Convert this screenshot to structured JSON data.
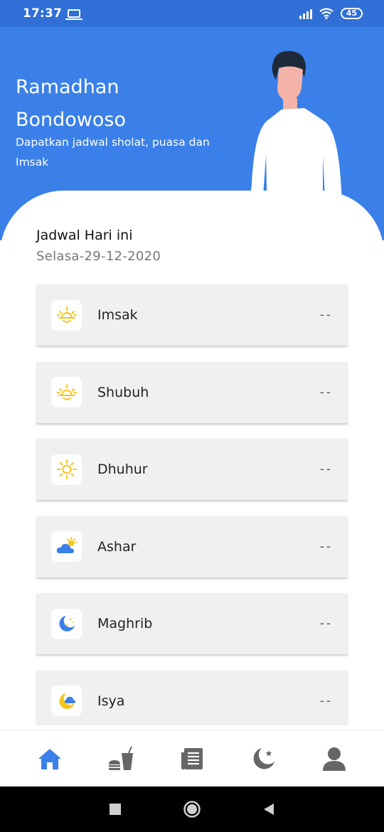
{
  "status_bar": {
    "time": "17:37",
    "battery": "45"
  },
  "header": {
    "title_line1": "Ramadhan",
    "title_line2": "Bondowoso",
    "subtitle": "Dapatkan jadwal sholat, puasa dan Imsak"
  },
  "schedule": {
    "title": "Jadwal Hari ini",
    "date": "Selasa-29-12-2020",
    "items": [
      {
        "name": "Imsak",
        "time": "--",
        "icon": "sunrise-icon"
      },
      {
        "name": "Shubuh",
        "time": "--",
        "icon": "sunrise-icon"
      },
      {
        "name": "Dhuhur",
        "time": "--",
        "icon": "sun-icon"
      },
      {
        "name": "Ashar",
        "time": "--",
        "icon": "cloud-sun-icon"
      },
      {
        "name": "Maghrib",
        "time": "--",
        "icon": "moon-stars-icon"
      },
      {
        "name": "Isya",
        "time": "--",
        "icon": "moon-cloud-icon"
      }
    ]
  },
  "bottom_nav": [
    {
      "icon": "home-icon",
      "active": true
    },
    {
      "icon": "food-drink-icon",
      "active": false
    },
    {
      "icon": "news-icon",
      "active": false
    },
    {
      "icon": "moon-star-icon",
      "active": false
    },
    {
      "icon": "profile-icon",
      "active": false
    }
  ],
  "colors": {
    "header": "#3a80e8",
    "active_nav": "#3a80e8",
    "inactive_nav": "#666666",
    "sun": "#f5c518"
  }
}
